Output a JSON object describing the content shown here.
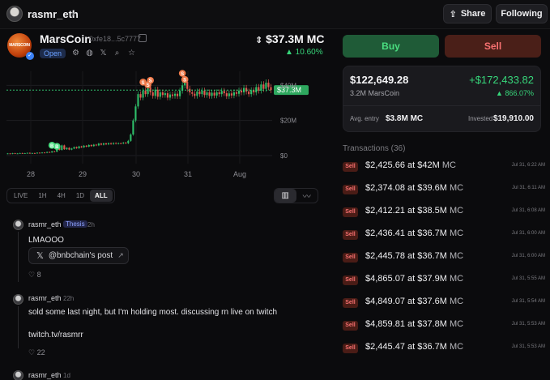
{
  "header": {
    "username": "rasmr_eth",
    "share_label": "Share",
    "following_label": "Following"
  },
  "coin": {
    "name": "MarsCoin",
    "logo_text": "MARSCOIN",
    "address": "0xfe18...5c7777",
    "status": "Open",
    "market_cap": "$37.3M MC",
    "change": "▲ 10.60%"
  },
  "chart_data": {
    "type": "candlestick",
    "x_ticks": [
      "28",
      "29",
      "30",
      "31",
      "Aug"
    ],
    "y_ticks": [
      "$40M",
      "$20M",
      "$0"
    ],
    "ylim": [
      0,
      48
    ],
    "current_price_label": "$37.3M",
    "current_value": 37.3,
    "markers": [
      "B",
      "B",
      "S",
      "S",
      "S",
      "S",
      "S"
    ],
    "candles": [
      [
        1.0,
        1.2
      ],
      [
        1.2,
        1.0
      ],
      [
        1.0,
        1.3
      ],
      [
        1.3,
        1.1
      ],
      [
        1.1,
        1.2
      ],
      [
        1.2,
        1.4
      ],
      [
        1.4,
        1.2
      ],
      [
        1.2,
        1.3
      ],
      [
        1.3,
        1.5
      ],
      [
        1.5,
        1.3
      ],
      [
        1.3,
        1.4
      ],
      [
        1.4,
        1.3
      ],
      [
        1.3,
        1.6
      ],
      [
        1.6,
        1.5
      ],
      [
        1.5,
        1.7
      ],
      [
        1.7,
        1.6
      ],
      [
        1.6,
        2.0
      ],
      [
        2.0,
        1.8
      ],
      [
        1.8,
        2.4
      ],
      [
        2.4,
        2.2
      ],
      [
        2.2,
        4.8
      ],
      [
        4.8,
        3.2
      ],
      [
        3.2,
        5.8
      ],
      [
        5.8,
        3.6
      ],
      [
        3.6,
        4.4
      ],
      [
        4.4,
        3.4
      ],
      [
        3.4,
        4.0
      ],
      [
        4.0,
        4.8
      ],
      [
        4.8,
        4.2
      ],
      [
        4.2,
        5.2
      ],
      [
        5.2,
        4.7
      ],
      [
        4.7,
        5.6
      ],
      [
        5.6,
        5.1
      ],
      [
        5.1,
        6.0
      ],
      [
        6.0,
        5.4
      ],
      [
        5.4,
        6.2
      ],
      [
        6.2,
        5.8
      ],
      [
        5.8,
        6.8
      ],
      [
        6.8,
        6.2
      ],
      [
        6.2,
        6.9
      ],
      [
        6.9,
        6.4
      ],
      [
        6.4,
        7.0
      ],
      [
        7.0,
        6.6
      ],
      [
        6.6,
        7.1
      ],
      [
        7.1,
        6.8
      ],
      [
        6.8,
        7.0
      ],
      [
        7.0,
        6.9
      ],
      [
        6.9,
        7.3
      ],
      [
        7.3,
        7.0
      ],
      [
        7.0,
        8.4
      ],
      [
        8.4,
        12.0
      ],
      [
        12.0,
        20.0
      ],
      [
        20.0,
        28.0
      ],
      [
        28.0,
        35.0
      ],
      [
        35.0,
        33.0
      ],
      [
        33.0,
        37.0
      ],
      [
        37.0,
        35.0
      ],
      [
        35.0,
        39.0
      ],
      [
        39.0,
        36.0
      ],
      [
        36.0,
        34.0
      ],
      [
        34.0,
        37.5
      ],
      [
        37.5,
        33.5
      ],
      [
        33.5,
        36.0
      ],
      [
        36.0,
        34.5
      ],
      [
        34.5,
        35.5
      ],
      [
        35.5,
        33.0
      ],
      [
        33.0,
        34.8
      ],
      [
        34.8,
        34.0
      ],
      [
        34.0,
        35.2
      ],
      [
        35.2,
        33.8
      ],
      [
        33.8,
        37.0
      ],
      [
        37.0,
        40.0
      ],
      [
        40.0,
        42.0
      ],
      [
        42.0,
        38.0
      ],
      [
        38.0,
        36.0
      ],
      [
        36.0,
        35.2
      ],
      [
        35.2,
        34.0
      ],
      [
        34.0,
        36.5
      ],
      [
        36.5,
        35.0
      ],
      [
        35.0,
        37.0
      ],
      [
        37.0,
        34.5
      ],
      [
        34.5,
        36.0
      ],
      [
        36.0,
        34.0
      ],
      [
        34.0,
        35.8
      ],
      [
        35.8,
        34.2
      ],
      [
        34.2,
        36.0
      ],
      [
        36.0,
        35.0
      ],
      [
        35.0,
        36.8
      ],
      [
        36.8,
        35.5
      ],
      [
        35.5,
        33.8
      ],
      [
        33.8,
        35.4
      ],
      [
        35.4,
        34.2
      ],
      [
        34.2,
        36.0
      ],
      [
        36.0,
        35.2
      ],
      [
        35.2,
        37.0
      ],
      [
        37.0,
        36.0
      ],
      [
        36.0,
        38.5
      ],
      [
        38.5,
        36.5
      ],
      [
        36.5,
        35.0
      ],
      [
        35.0,
        37.2
      ],
      [
        37.2,
        36.0
      ],
      [
        36.0,
        39.0
      ],
      [
        39.0,
        37.0
      ],
      [
        37.0,
        40.5
      ],
      [
        40.5,
        38.0
      ],
      [
        38.0,
        41.5
      ],
      [
        41.5,
        39.0
      ],
      [
        39.0,
        37.3
      ]
    ]
  },
  "timeframes": [
    "LIVE",
    "1H",
    "4H",
    "1D",
    "ALL"
  ],
  "active_timeframe": "ALL",
  "posts": [
    {
      "user": "rasmr_eth",
      "badge": "Thesis",
      "time": "2h",
      "text": "LMAOOO",
      "link": "@bnbchain's post",
      "likes": "8"
    },
    {
      "user": "rasmr_eth",
      "time": "22h",
      "text": "sold some last night, but I'm holding most. discussing rn live on twitch",
      "text2": "twitch.tv/rasmrr",
      "likes": "22"
    },
    {
      "user": "rasmr_eth",
      "time": "1d"
    }
  ],
  "trade": {
    "buy_label": "Buy",
    "sell_label": "Sell"
  },
  "position": {
    "value": "$122,649.28",
    "pnl": "+$172,433.82",
    "holdings": "3.2M MarsCoin",
    "pnl_pct": "▲ 866.07%",
    "avg_entry_label": "Avg. entry",
    "avg_entry": "$3.8M MC",
    "invested_label": "Invested",
    "invested": "$19,910.00"
  },
  "transactions_header": "Transactions (36)",
  "transactions": [
    {
      "type": "Sell",
      "amount": "$2,425.66",
      "mc": "$42M",
      "time": "Jul 31, 6:22 AM"
    },
    {
      "type": "Sell",
      "amount": "$2,374.08",
      "mc": "$39.6M",
      "time": "Jul 31, 6:11 AM"
    },
    {
      "type": "Sell",
      "amount": "$2,412.21",
      "mc": "$38.5M",
      "time": "Jul 31, 6:08 AM"
    },
    {
      "type": "Sell",
      "amount": "$2,436.41",
      "mc": "$36.7M",
      "time": "Jul 31, 6:00 AM"
    },
    {
      "type": "Sell",
      "amount": "$2,445.78",
      "mc": "$36.7M",
      "time": "Jul 31, 6:00 AM"
    },
    {
      "type": "Sell",
      "amount": "$4,865.07",
      "mc": "$37.9M",
      "time": "Jul 31, 5:55 AM"
    },
    {
      "type": "Sell",
      "amount": "$4,849.07",
      "mc": "$37.6M",
      "time": "Jul 31, 5:54 AM"
    },
    {
      "type": "Sell",
      "amount": "$4,859.81",
      "mc": "$37.8M",
      "time": "Jul 31, 5:53 AM"
    },
    {
      "type": "Sell",
      "amount": "$2,445.47",
      "mc": "$36.7M",
      "time": "Jul 31, 5:53 AM"
    }
  ],
  "tx_connector": "at",
  "tx_suffix": "MC",
  "colors": {
    "green": "#37d67a",
    "red": "#f87171",
    "background": "#0b0b0d"
  }
}
